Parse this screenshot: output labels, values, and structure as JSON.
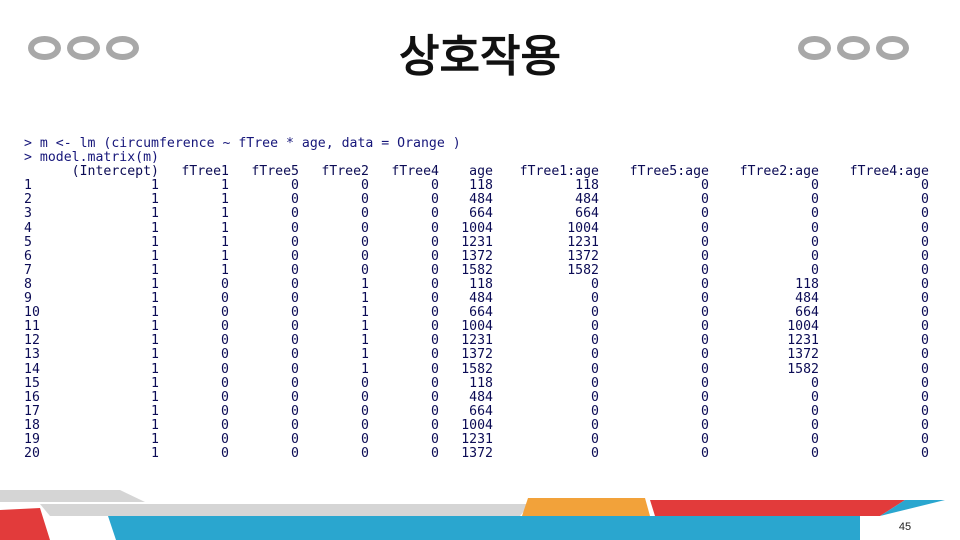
{
  "slide": {
    "title": "상호작용",
    "page_number": "45"
  },
  "console": {
    "commands": [
      "> m <- lm (circumference ~ fTree * age, data = Orange )",
      "> model.matrix(m)"
    ],
    "headers": [
      "",
      "(Intercept)",
      "fTree1",
      "fTree5",
      "fTree2",
      "fTree4",
      "age",
      "fTree1:age",
      "fTree5:age",
      "fTree2:age",
      "fTree4:age"
    ],
    "rows": [
      [
        "1",
        "1",
        "1",
        "0",
        "0",
        "0",
        "118",
        "118",
        "0",
        "0",
        "0"
      ],
      [
        "2",
        "1",
        "1",
        "0",
        "0",
        "0",
        "484",
        "484",
        "0",
        "0",
        "0"
      ],
      [
        "3",
        "1",
        "1",
        "0",
        "0",
        "0",
        "664",
        "664",
        "0",
        "0",
        "0"
      ],
      [
        "4",
        "1",
        "1",
        "0",
        "0",
        "0",
        "1004",
        "1004",
        "0",
        "0",
        "0"
      ],
      [
        "5",
        "1",
        "1",
        "0",
        "0",
        "0",
        "1231",
        "1231",
        "0",
        "0",
        "0"
      ],
      [
        "6",
        "1",
        "1",
        "0",
        "0",
        "0",
        "1372",
        "1372",
        "0",
        "0",
        "0"
      ],
      [
        "7",
        "1",
        "1",
        "0",
        "0",
        "0",
        "1582",
        "1582",
        "0",
        "0",
        "0"
      ],
      [
        "8",
        "1",
        "0",
        "0",
        "1",
        "0",
        "118",
        "0",
        "0",
        "118",
        "0"
      ],
      [
        "9",
        "1",
        "0",
        "0",
        "1",
        "0",
        "484",
        "0",
        "0",
        "484",
        "0"
      ],
      [
        "10",
        "1",
        "0",
        "0",
        "1",
        "0",
        "664",
        "0",
        "0",
        "664",
        "0"
      ],
      [
        "11",
        "1",
        "0",
        "0",
        "1",
        "0",
        "1004",
        "0",
        "0",
        "1004",
        "0"
      ],
      [
        "12",
        "1",
        "0",
        "0",
        "1",
        "0",
        "1231",
        "0",
        "0",
        "1231",
        "0"
      ],
      [
        "13",
        "1",
        "0",
        "0",
        "1",
        "0",
        "1372",
        "0",
        "0",
        "1372",
        "0"
      ],
      [
        "14",
        "1",
        "0",
        "0",
        "1",
        "0",
        "1582",
        "0",
        "0",
        "1582",
        "0"
      ],
      [
        "15",
        "1",
        "0",
        "0",
        "0",
        "0",
        "118",
        "0",
        "0",
        "0",
        "0"
      ],
      [
        "16",
        "1",
        "0",
        "0",
        "0",
        "0",
        "484",
        "0",
        "0",
        "0",
        "0"
      ],
      [
        "17",
        "1",
        "0",
        "0",
        "0",
        "0",
        "664",
        "0",
        "0",
        "0",
        "0"
      ],
      [
        "18",
        "1",
        "0",
        "0",
        "0",
        "0",
        "1004",
        "0",
        "0",
        "0",
        "0"
      ],
      [
        "19",
        "1",
        "0",
        "0",
        "0",
        "0",
        "1231",
        "0",
        "0",
        "0",
        "0"
      ],
      [
        "20",
        "1",
        "0",
        "0",
        "0",
        "0",
        "1372",
        "0",
        "0",
        "0",
        "0"
      ]
    ]
  },
  "theme": {
    "ring_color": "#a8a8a8",
    "footer_red": "#e23b3b",
    "footer_blue": "#2aa6cf",
    "footer_orange": "#f2a23a",
    "footer_gray": "#d5d5d5",
    "console_text": "#0b0b55"
  }
}
